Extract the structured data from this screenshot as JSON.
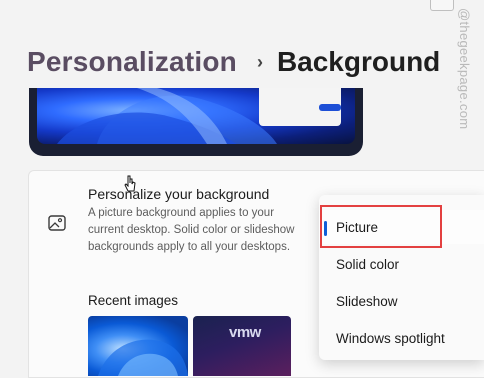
{
  "watermark": "@thegeekpage.com",
  "breadcrumb": {
    "parent": "Personalization",
    "separator": "›",
    "current": "Background"
  },
  "personalize": {
    "title": "Personalize your background",
    "description": "A picture background applies to your current desktop. Solid color or slideshow backgrounds apply to all your desktops."
  },
  "recent": {
    "label": "Recent images",
    "thumb_texts": [
      "",
      "vmw"
    ]
  },
  "menu": {
    "items": [
      {
        "label": "Picture",
        "selected": true
      },
      {
        "label": "Solid color",
        "selected": false
      },
      {
        "label": "Slideshow",
        "selected": false
      },
      {
        "label": "Windows spotlight",
        "selected": false
      }
    ]
  },
  "colors": {
    "accent": "#0f5fd7",
    "highlight": "#e34040",
    "breadcrumb_parent": "#5a4d62"
  },
  "icons": {
    "picture": "image-icon",
    "chevron": "chevron-down-icon",
    "cursor": "mouse-cursor-icon"
  }
}
